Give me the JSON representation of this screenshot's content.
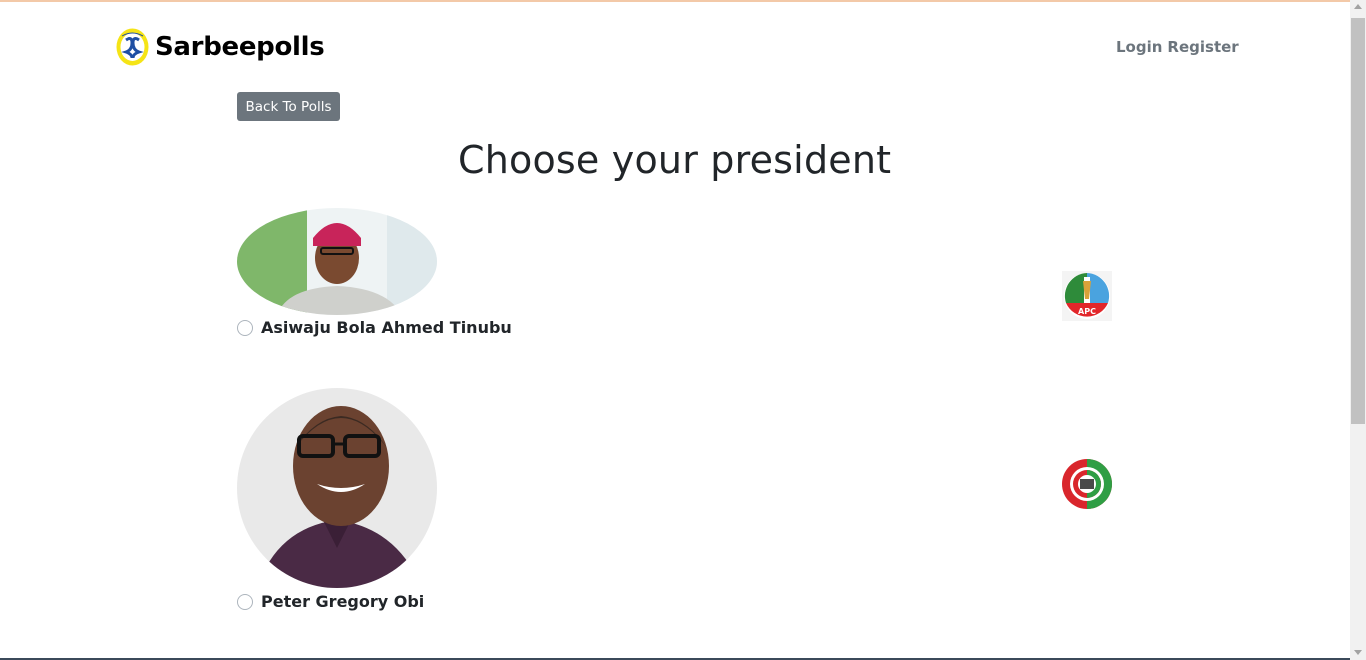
{
  "brand": {
    "name": "Sarbeepolls",
    "logo_icon": "sarbeepolls-logo-icon"
  },
  "nav": {
    "login": "Login",
    "register": "Register"
  },
  "back_button": {
    "label": "Back To Polls"
  },
  "page": {
    "title": "Choose your president"
  },
  "candidates": [
    {
      "name": "Asiwaju Bola Ahmed Tinubu",
      "party_logo": "apc-party-logo",
      "party_logo_text": "APC"
    },
    {
      "name": "Peter Gregory Obi",
      "party_logo": "labour-party-logo"
    }
  ],
  "colors": {
    "button_bg": "#6c757d",
    "nav_link": "#6c757d",
    "title": "#212529",
    "apc_green": "#2e8b3a",
    "apc_red": "#e2262a",
    "apc_blue": "#4aa3df",
    "lp_red": "#d9262c",
    "lp_green": "#2f9e44"
  }
}
